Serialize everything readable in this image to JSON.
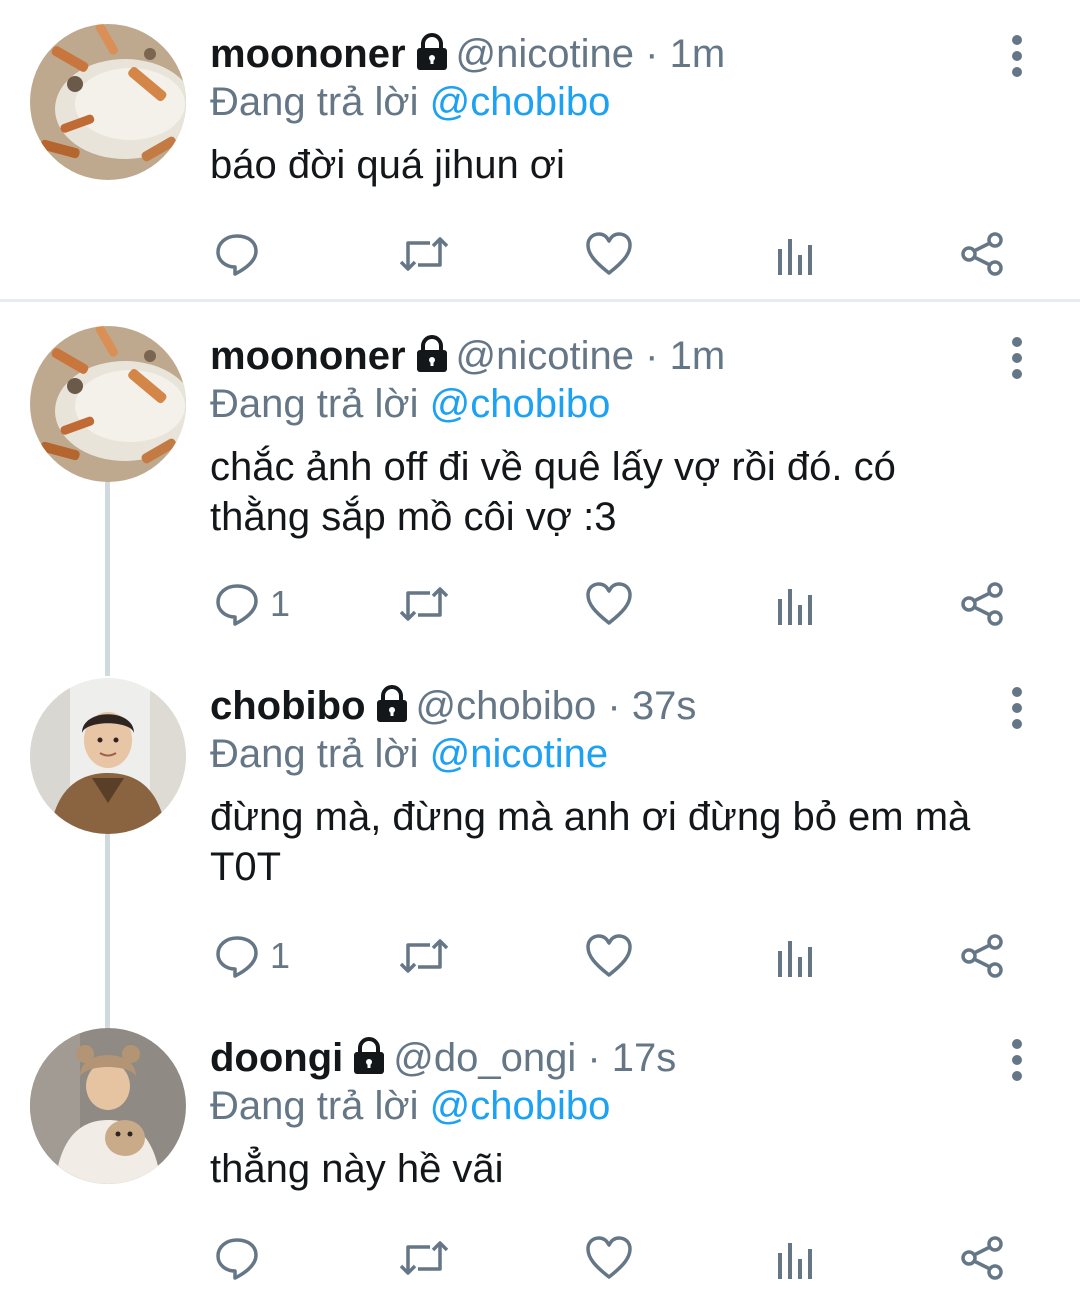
{
  "reply_prefix": "Đang trả lời",
  "tweets": [
    {
      "name": "moononer",
      "handle": "@nicotine",
      "time": "· 1m",
      "reply_to": "@chobibo",
      "lines": [
        "báo đời quá jihun ơi"
      ],
      "reply_count": ""
    },
    {
      "name": "moononer",
      "handle": "@nicotine",
      "time": "· 1m",
      "reply_to": "@chobibo",
      "lines": [
        "chắc ảnh off đi về quê lấy vợ rồi đó. có",
        "thằng sắp mồ côi vợ :3"
      ],
      "reply_count": "1"
    },
    {
      "name": "chobibo",
      "handle": "@chobibo",
      "time": "· 37s",
      "reply_to": "@nicotine",
      "lines": [
        "đừng mà, đừng mà anh ơi đừng bỏ em mà",
        "T0T"
      ],
      "reply_count": "1"
    },
    {
      "name": "doongi",
      "handle": "@do_ongi",
      "time": "· 17s",
      "reply_to": "@chobibo",
      "lines": [
        "thẳng này hề vãi"
      ],
      "reply_count": ""
    }
  ],
  "icons": {
    "reply": "reply-icon",
    "retweet": "retweet-icon",
    "like": "heart-icon",
    "analytics": "analytics-icon",
    "share": "share-icon",
    "more": "more-vertical-icon",
    "protected": "lock-icon"
  },
  "colors": {
    "text": "#14171a",
    "secondary": "#657786",
    "accent": "#1da1f2",
    "divider": "#e6ecf0",
    "thread_line": "#cfd9de"
  }
}
